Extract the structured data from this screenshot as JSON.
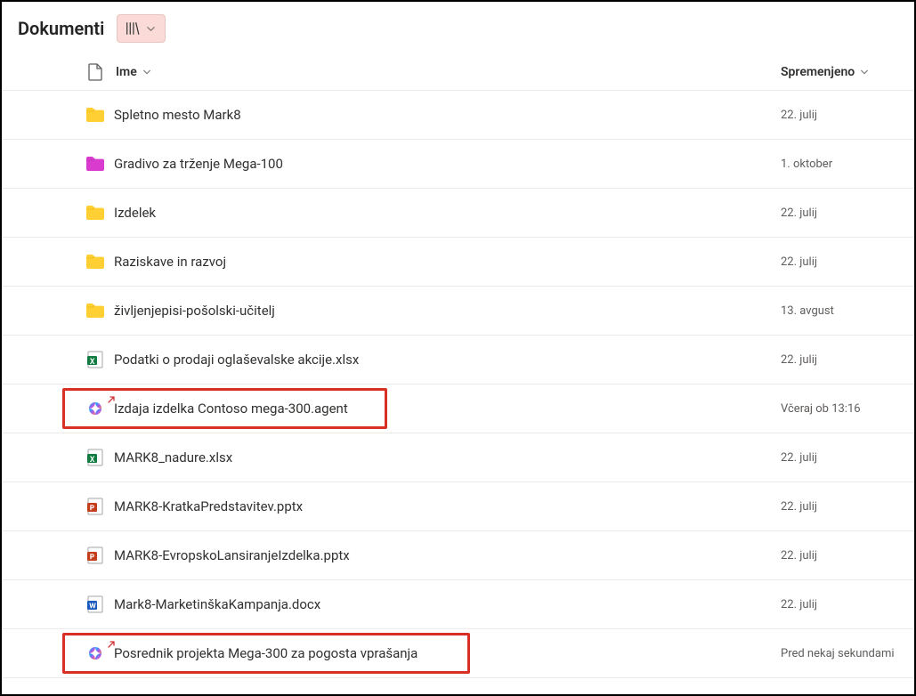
{
  "header": {
    "title": "Dokumenti"
  },
  "columns": {
    "name": "Ime",
    "modified": "Spremenjeno"
  },
  "rows": [
    {
      "icon": "folder-yellow",
      "name": "Spletno mesto Mark8",
      "modified": "22. julij"
    },
    {
      "icon": "folder-pink",
      "name": "Gradivo za trženje Mega-100",
      "modified": "1. oktober"
    },
    {
      "icon": "folder-yellow",
      "name": "Izdelek",
      "modified": "22. julij"
    },
    {
      "icon": "folder-yellow",
      "name": "Raziskave in razvoj",
      "modified": "22. julij"
    },
    {
      "icon": "folder-yellow",
      "name": "življenjepisi-pošolski-učitelj",
      "modified": "13. avgust"
    },
    {
      "icon": "excel",
      "name": "Podatki o prodaji oglaševalske akcije.xlsx",
      "modified": "22. julij"
    },
    {
      "icon": "copilot",
      "name": "Izdaja izdelka Contoso mega-300.agent",
      "modified": "Včeraj ob 13:16",
      "highlight": 1,
      "shared": true
    },
    {
      "icon": "excel",
      "name": "MARK8_nadure.xlsx",
      "modified": "22. julij"
    },
    {
      "icon": "powerpoint",
      "name": "MARK8-KratkaPredstavitev.pptx",
      "modified": "22. julij"
    },
    {
      "icon": "powerpoint",
      "name": "MARK8-EvropskoLansiranjeIzdelka.pptx",
      "modified": "22. julij"
    },
    {
      "icon": "word",
      "name": "Mark8-MarketinškaKampanja.docx",
      "modified": "22. julij"
    },
    {
      "icon": "copilot",
      "name": "Posrednik projekta Mega-300 za pogosta vprašanja",
      "modified": "Pred nekaj sekundami",
      "highlight": 2,
      "shared": true
    }
  ]
}
